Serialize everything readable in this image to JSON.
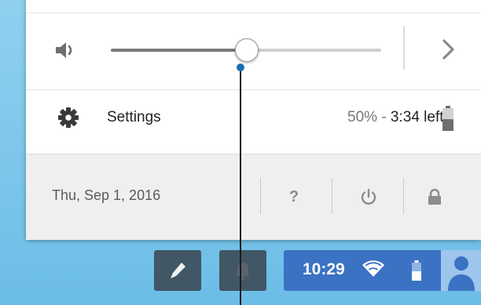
{
  "volume": {
    "level": 0.5,
    "icon": "speaker-icon",
    "more_icon": "chevron-right-icon"
  },
  "settings": {
    "label": "Settings",
    "icon": "gear-icon"
  },
  "battery": {
    "percent": "50%",
    "separator": "-",
    "time_left": "3:34 left",
    "level": 0.5,
    "icon": "battery-icon"
  },
  "footer": {
    "date": "Thu, Sep 1, 2016",
    "help_label": "?",
    "icons": [
      "help-icon",
      "power-icon",
      "lock-icon"
    ]
  },
  "shelf": {
    "clock": "10:29",
    "icons": [
      "stylus-icon",
      "notifications-icon",
      "wifi-icon",
      "battery-icon",
      "avatar-icon"
    ]
  },
  "colors": {
    "accent": "#3b72c3",
    "panel_bg": "#ffffff",
    "footer_bg": "#efefef",
    "desktop_bg": "#7cc6ea",
    "callout_dot": "#1a6fb0"
  }
}
